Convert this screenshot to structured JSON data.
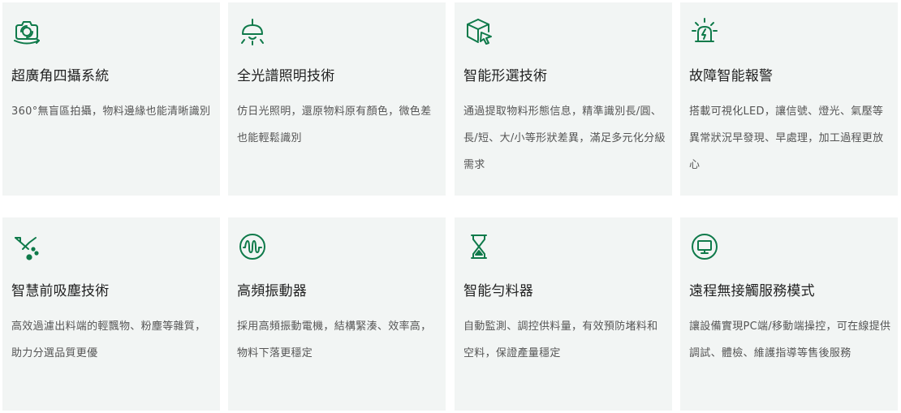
{
  "colors": {
    "accent": "#0f7a4a",
    "card_bg": "#f2f5f4",
    "title": "#222222",
    "desc": "#555555"
  },
  "cards": [
    {
      "icon": "camera-rotate-icon",
      "title": "超廣角四攝系統",
      "desc": "360°無盲區拍攝，物料邊緣也能清晰識別"
    },
    {
      "icon": "pendant-lamp-icon",
      "title": "全光譜照明技術",
      "desc": "仿日光照明，還原物料原有顏色，微色差也能輕鬆識別"
    },
    {
      "icon": "cube-cursor-icon",
      "title": "智能形選技術",
      "desc": "通過提取物料形態信息，精準識別長/圓、長/短、大/小等形狀差異，滿足多元化分級需求"
    },
    {
      "icon": "alarm-light-icon",
      "title": "故障智能報警",
      "desc": "搭載可視化LED，讓信號、燈光、氣壓等異常狀況早發現、早處理，加工過程更放心"
    },
    {
      "icon": "dust-filter-icon",
      "title": "智慧前吸塵技術",
      "desc": "高效過濾出料端的輕飄物、粉塵等雜質，助力分選品質更優"
    },
    {
      "icon": "vibration-wave-icon",
      "title": "高頻振動器",
      "desc": "採用高頻振動電機，結構緊湊、效率高，物料下落更穩定"
    },
    {
      "icon": "hourglass-icon",
      "title": "智能勻料器",
      "desc": "自動監測、調控供料量，有效預防堵料和空料，保證產量穩定"
    },
    {
      "icon": "monitor-icon",
      "title": "遠程無接觸服務模式",
      "desc": "讓設備實現PC端/移動端操控，可在線提供調試、體檢、維護指導等售後服務"
    }
  ]
}
